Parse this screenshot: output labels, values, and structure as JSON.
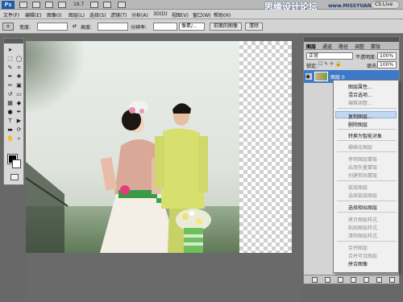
{
  "app": {
    "logo": "Ps",
    "zoom": "16.7",
    "live": "CS Live"
  },
  "watermark": {
    "title": "思缘设计论坛",
    "url": "www.MISSYUAN.COM"
  },
  "menubar": [
    "文件(F)",
    "编辑(E)",
    "图像(I)",
    "图层(L)",
    "选择(S)",
    "滤镜(T)",
    "分析(A)",
    "3D(D)",
    "视图(V)",
    "窗口(W)",
    "帮助(H)"
  ],
  "options": {
    "width_label": "宽度:",
    "height_label": "高度:",
    "resolution_label": "分辨率:",
    "unit": "像素/...",
    "front_image_button": "前面的图像",
    "clear_button": "清除"
  },
  "layers": {
    "tabs": [
      "图层",
      "通道",
      "路径",
      "调整",
      "蒙版"
    ],
    "blend_mode": "正常",
    "opacity_label": "不透明度:",
    "opacity": "100%",
    "lock_label": "锁定:",
    "fill_label": "填充:",
    "fill": "100%",
    "layer_name": "图层 0"
  },
  "context_menu": {
    "items": [
      {
        "label": "图层属性...",
        "enabled": true
      },
      {
        "label": "混合选项...",
        "enabled": true
      },
      {
        "label": "编辑调整...",
        "enabled": false
      },
      {
        "label": "复制图层...",
        "enabled": true
      },
      {
        "label": "删除图层",
        "enabled": true
      },
      {
        "label": "转换为智能对象",
        "enabled": true
      },
      {
        "label": "栅格化图层",
        "enabled": false
      },
      {
        "label": "停用图层蒙版",
        "enabled": false
      },
      {
        "label": "启用矢量蒙版",
        "enabled": false
      },
      {
        "label": "创建剪贴蒙版",
        "enabled": false
      },
      {
        "label": "链接图层",
        "enabled": false
      },
      {
        "label": "选择链接图层",
        "enabled": false
      },
      {
        "label": "选择相似图层",
        "enabled": true
      },
      {
        "label": "拷贝图层样式",
        "enabled": false
      },
      {
        "label": "粘贴图层样式",
        "enabled": false
      },
      {
        "label": "清除图层样式",
        "enabled": false
      },
      {
        "label": "合并图层",
        "enabled": false
      },
      {
        "label": "合并可见图层",
        "enabled": false
      },
      {
        "label": "拼合图像",
        "enabled": true
      }
    ],
    "highlighted": "复制图层..."
  },
  "colors": {
    "selection": "#3d79c8",
    "menu_highlight": "#c3d7f1"
  }
}
